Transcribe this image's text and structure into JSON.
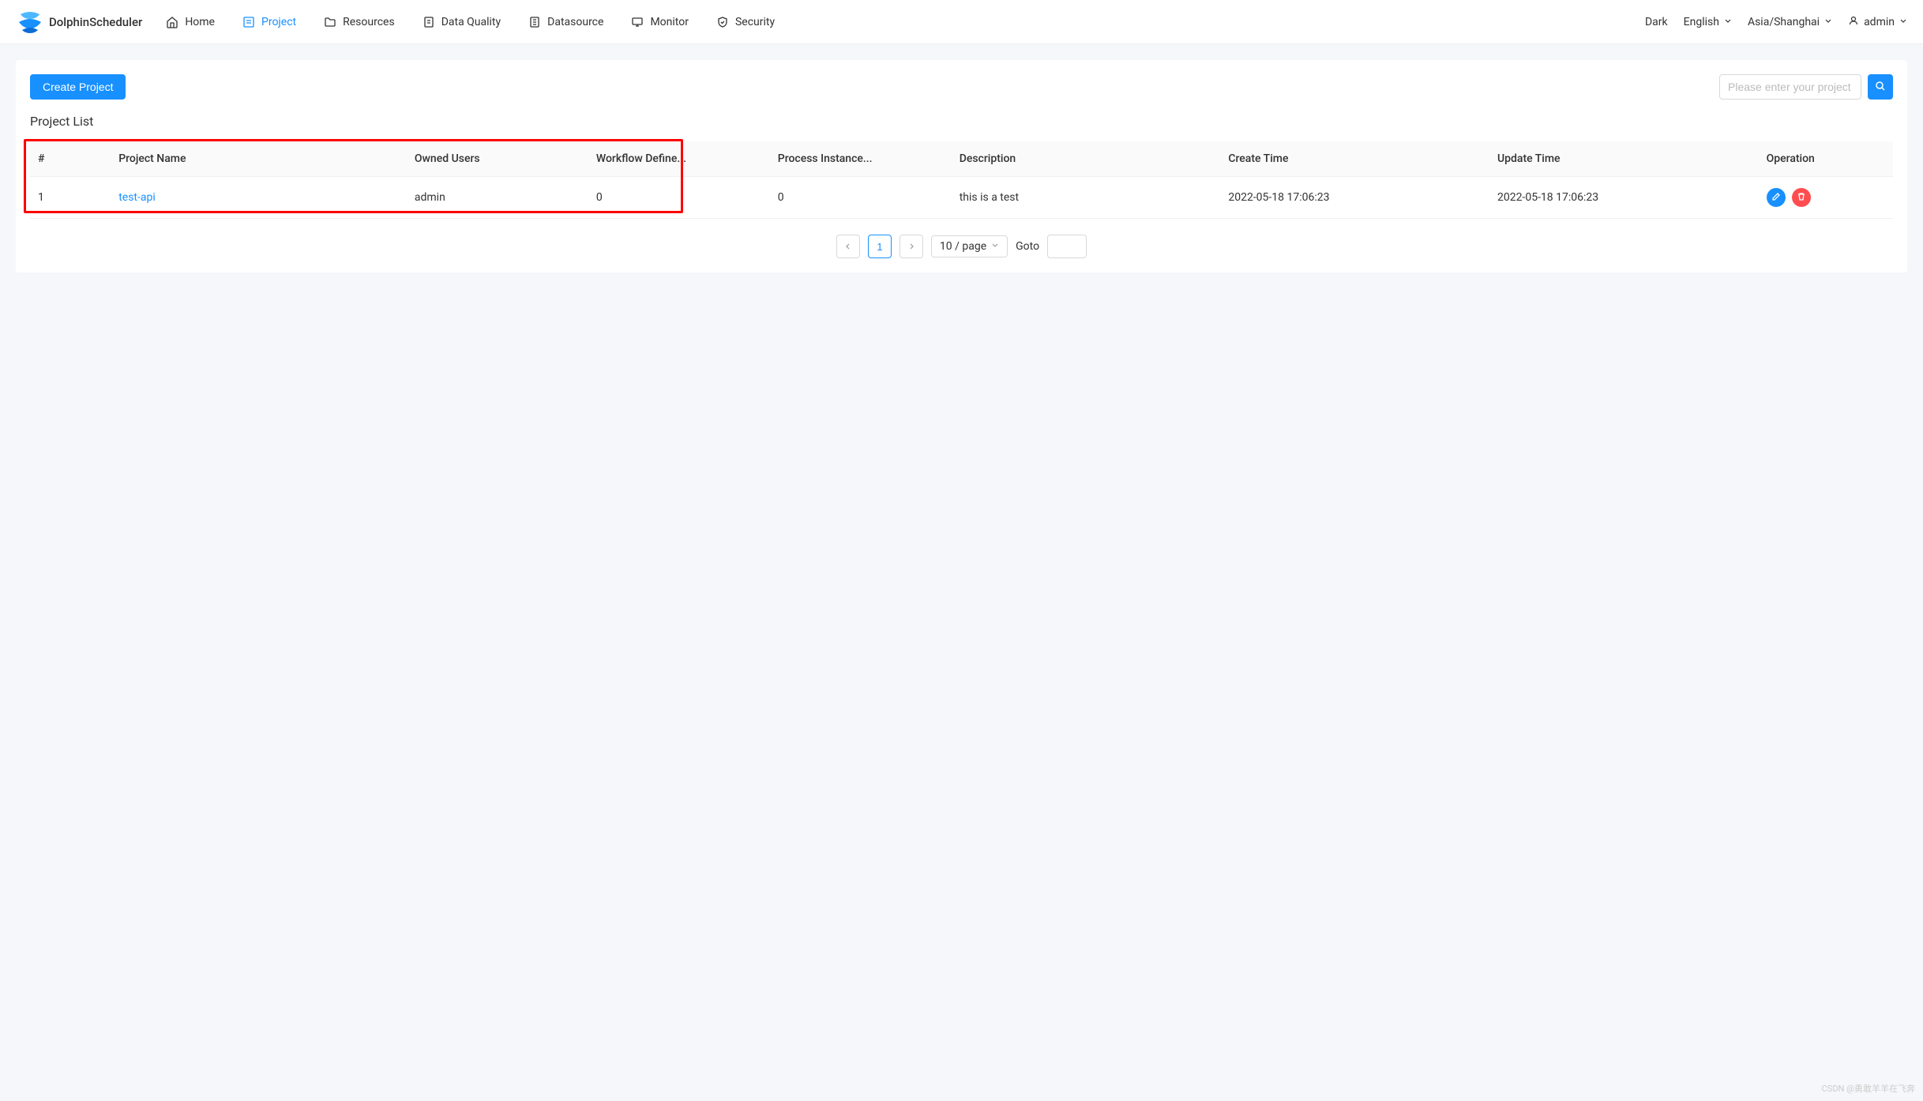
{
  "brand": "DolphinScheduler",
  "nav": {
    "home": "Home",
    "project": "Project",
    "resources": "Resources",
    "data_quality": "Data Quality",
    "datasource": "Datasource",
    "monitor": "Monitor",
    "security": "Security"
  },
  "header_right": {
    "theme": "Dark",
    "language": "English",
    "timezone": "Asia/Shanghai",
    "username": "admin"
  },
  "toolbar": {
    "create_label": "Create Project",
    "search_placeholder": "Please enter your project"
  },
  "section_title": "Project List",
  "columns": {
    "idx": "#",
    "name": "Project Name",
    "user": "Owned Users",
    "wf": "Workflow Define...",
    "pi": "Process Instance...",
    "desc": "Description",
    "ct": "Create Time",
    "ut": "Update Time",
    "op": "Operation"
  },
  "rows": [
    {
      "idx": "1",
      "name": "test-api",
      "user": "admin",
      "wf": "0",
      "pi": "0",
      "desc": "this is a test",
      "ct": "2022-05-18 17:06:23",
      "ut": "2022-05-18 17:06:23"
    }
  ],
  "pagination": {
    "current": "1",
    "page_size_label": "10 / page",
    "goto_label": "Goto"
  },
  "watermark": "CSDN @勇敢羊羊在飞奔"
}
